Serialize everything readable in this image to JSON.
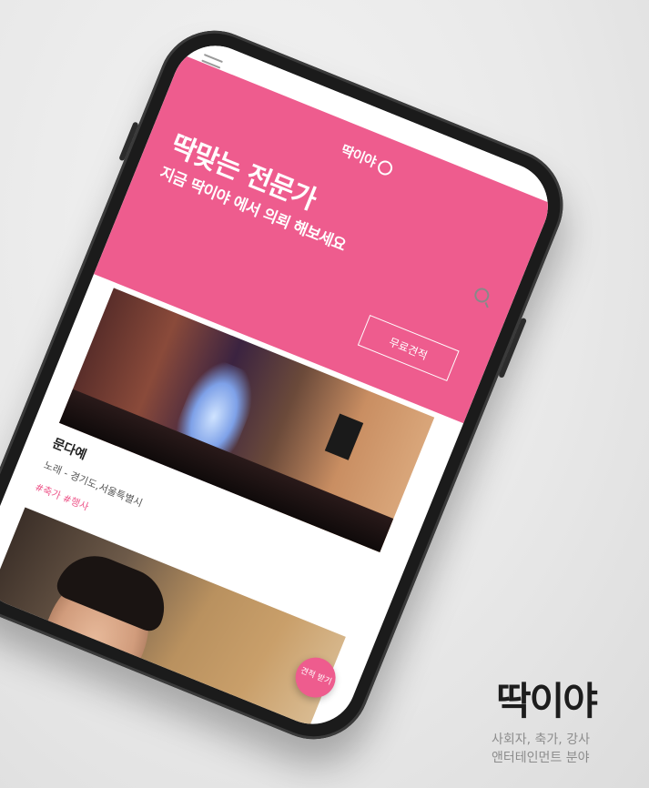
{
  "app": {
    "logo": "딱이야",
    "menu_icon": "hamburger-icon",
    "search_icon": "search-icon"
  },
  "hero": {
    "title": "딱맞는 전문가",
    "subtitle": "지금 딱이야 에서 의뢰 해보세요",
    "cta_label": "무료견적"
  },
  "cards": [
    {
      "name": "문다예",
      "meta": "노래 - 경기도,서울특별시",
      "tags": "#축가 #행사"
    }
  ],
  "fab": {
    "label": "견적 받기"
  },
  "brand": {
    "title": "딱이야",
    "desc_line1": "사회자, 축가, 강사",
    "desc_line2": "앤터테인먼트 분야"
  },
  "colors": {
    "accent": "#ee5c8e",
    "phone": "#1b1b1b",
    "background": "#e9e9e9"
  }
}
